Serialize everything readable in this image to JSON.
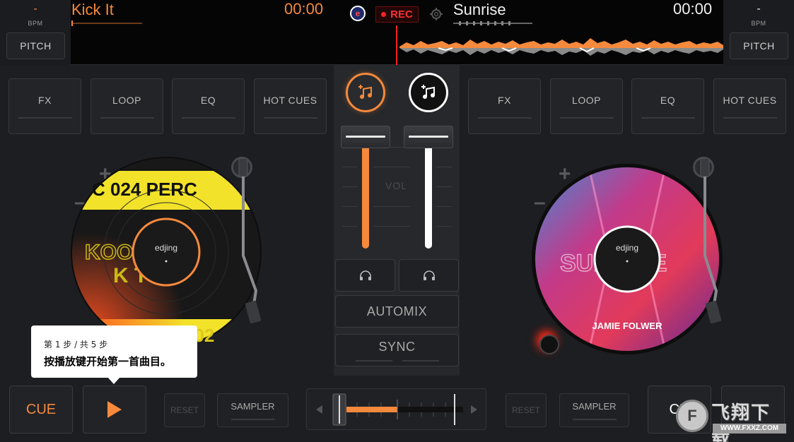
{
  "deck_left": {
    "bpm_value": "-",
    "bpm_label": "BPM",
    "pitch_label": "PITCH",
    "title": "Kick It",
    "time": "00:00",
    "tabs": [
      "FX",
      "LOOP",
      "EQ",
      "HOT CUES"
    ],
    "record_label": {
      "top_text": "C 024 PERC",
      "middle_text_1": "KOO PERC",
      "middle_text_2": "K      T",
      "bottom_text": "PERC 02",
      "brand": "edjing"
    },
    "cue_label": "CUE",
    "reset_label": "RESET",
    "sampler_label": "SAMPLER",
    "accent": "#f5893c"
  },
  "deck_right": {
    "bpm_value": "-",
    "bpm_label": "BPM",
    "pitch_label": "PITCH",
    "title": "Sunrise",
    "time": "00:00",
    "tabs": [
      "FX",
      "LOOP",
      "EQ",
      "HOT CUES"
    ],
    "record_label": {
      "title_text": "SUNRISE",
      "artist": "JAMIE FOLWER",
      "brand": "edjing"
    },
    "cue_label": "CU",
    "reset_label": "RESET",
    "sampler_label": "SAMPLER",
    "accent": "#ffffff"
  },
  "header": {
    "rec_label": "REC",
    "logo_icon": "edjing-e-icon",
    "settings_icon": "gear-icon"
  },
  "mixer": {
    "vol_label": "VOL",
    "automix_label": "AUTOMIX",
    "sync_label": "SYNC",
    "left_volume": 0.85,
    "right_volume": 0.85,
    "crossfader_position": 0.5
  },
  "tooltip": {
    "step_text": "第 1 步 / 共 5 步",
    "message": "按播放键开始第一首曲目。"
  },
  "watermark": {
    "text_cn": "飞翔下载",
    "url": "WWW.FXXZ.COM"
  },
  "colors": {
    "orange": "#f5893c",
    "rec_red": "#ff2a2a",
    "background": "#1d1e21"
  }
}
